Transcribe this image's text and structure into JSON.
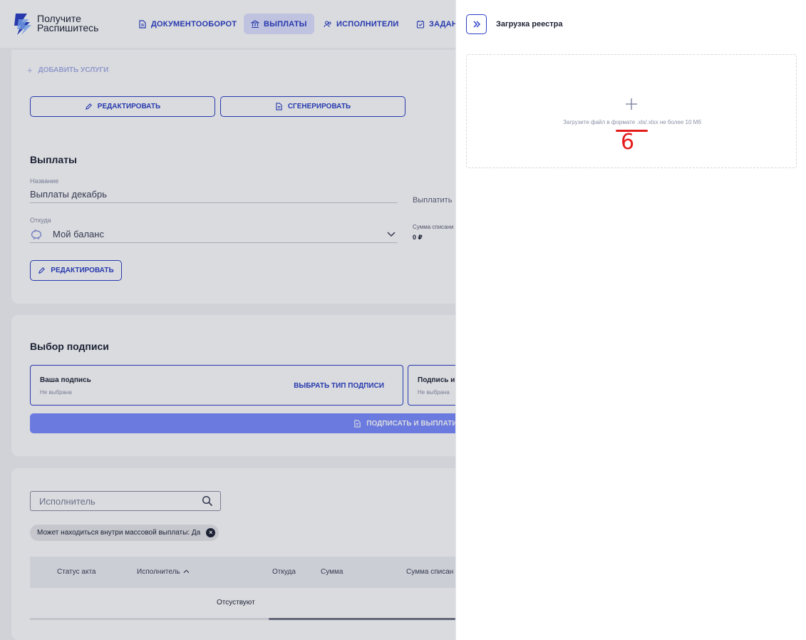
{
  "app": {
    "logo_text_line1": "Получите",
    "logo_text_line2": "Распишитесь",
    "nav": [
      {
        "label": "ДОКУМЕНТООБОРОТ",
        "icon": "document-icon",
        "active": false
      },
      {
        "label": "ВЫПЛАТЫ",
        "icon": "bank-icon",
        "active": true
      },
      {
        "label": "ИСПОЛНИТЕЛИ",
        "icon": "users-icon",
        "active": false
      },
      {
        "label": "ЗАДАНИ",
        "icon": "calendar-check-icon",
        "active": false
      }
    ]
  },
  "services": {
    "add_label": "ДОБАВИТЬ УСЛУГИ",
    "edit_label": "РЕДАКТИРОВАТЬ",
    "generate_label": "СГЕНЕРИРОВАТЬ"
  },
  "payments": {
    "title": "Выплаты",
    "name_label": "Название",
    "name_value": "Выплаты декабрь",
    "from_label": "Откуда",
    "from_value": "Мой баланс",
    "pay_label": "Выплатить",
    "sum_label": "Сумма списани",
    "sum_value": "0 ₽",
    "edit_label": "РЕДАКТИРОВАТЬ"
  },
  "signature": {
    "title": "Выбор подписи",
    "your_title": "Ваша подпись",
    "your_status": "Не выбрана",
    "choose_label": "ВЫБРАТЬ ТИП ПОДПИСИ",
    "other_title": "Подпись и",
    "other_status": "Не выбрана",
    "sign_pay_label": "ПОДПИСАТЬ И ВЫПЛАТИТ"
  },
  "table": {
    "search_placeholder": "Исполнитель",
    "chip_label": "Может находиться внутри массовой выплаты: Да",
    "columns": [
      "Статус акта",
      "Исполнитель",
      "Откуда",
      "Сумма",
      "Сумма списан"
    ],
    "empty_text": "Отсуствуют"
  },
  "drawer": {
    "title": "Загрузка реестра",
    "upload_hint": "Загрузите файл в формате .xls/.xlsx не более 10 Мб",
    "annotation_number": "6"
  },
  "colors": {
    "accent": "#2a3fc4",
    "primary_button": "#7b8cff",
    "annotation": "#e51b1b"
  }
}
